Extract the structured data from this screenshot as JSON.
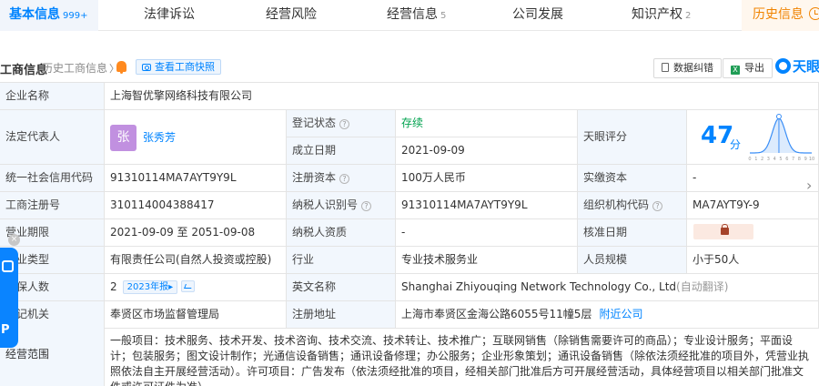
{
  "tabs": [
    {
      "label": "基本信息",
      "count": "999+"
    },
    {
      "label": "法律诉讼",
      "count": ""
    },
    {
      "label": "经营风险",
      "count": ""
    },
    {
      "label": "经营信息",
      "count": "5"
    },
    {
      "label": "公司发展",
      "count": ""
    },
    {
      "label": "知识产权",
      "count": "2"
    },
    {
      "label": "历史信息",
      "count": ""
    }
  ],
  "section": {
    "title": "工商信息",
    "history_link": "历史工商信息",
    "snapshot_label": "查看工商快照",
    "error_label": "数据纠错",
    "export_label": "导出",
    "logo_text": "天眼"
  },
  "info": {
    "company_name_label": "企业名称",
    "company_name": "上海智优擎网络科技有限公司",
    "legal_rep_label": "法定代表人",
    "legal_rep_avatar": "张",
    "legal_rep_name": "张秀芳",
    "reg_status_label": "登记状态",
    "reg_status": "存续",
    "est_date_label": "成立日期",
    "est_date": "2021-09-09",
    "tianyan_score_label": "天眼评分",
    "tianyan_score": "47",
    "score_unit": "分",
    "credit_code_label": "统一社会信用代码",
    "credit_code": "91310114MA7AYT9Y9L",
    "reg_capital_label": "注册资本",
    "reg_capital": "100万人民币",
    "paid_capital_label": "实缴资本",
    "paid_capital": "-",
    "reg_number_label": "工商注册号",
    "reg_number": "310114004388417",
    "taxpayer_id_label": "纳税人识别号",
    "taxpayer_id": "91310114MA7AYT9Y9L",
    "org_code_label": "组织机构代码",
    "org_code": "MA7AYT9Y-9",
    "term_label": "营业期限",
    "term": "2021-09-09 至 2051-09-08",
    "taxpayer_qual_label": "纳税人资质",
    "taxpayer_qual": "-",
    "approval_date_label": "核准日期",
    "company_type_label": "企业类型",
    "company_type": "有限责任公司(自然人投资或控股)",
    "industry_label": "行业",
    "industry": "专业技术服务业",
    "staff_size_label": "人员规模",
    "staff_size": "小于50人",
    "insured_label": "参保人数",
    "insured": "2",
    "insured_report": "2023年报",
    "english_name_label": "英文名称",
    "english_name": "Shanghai Zhiyouqing Network Technology Co., Ltd",
    "auto_translate": "(自动翻译)",
    "authority_label": "登记机关",
    "authority": "奉贤区市场监督管理局",
    "address_label": "注册地址",
    "address": "上海市奉贤区金海公路6055号11幢5层",
    "nearby_label": "附近公司",
    "scope_label": "经营范围",
    "scope": "一般项目：技术服务、技术开发、技术咨询、技术交流、技术转让、技术推广；互联网销售（除销售需要许可的商品）；专业设计服务；平面设计；包装服务；图文设计制作；光通信设备销售；通讯设备修理；办公服务；企业形象策划；通讯设备销售（除依法须经批准的项目外，凭营业执照依法自主开展经营活动）。许可项目：广告发布（依法须经批准的项目，经相关部门批准后方可开展经营活动，具体经营项目以相关部门批准文件或许可证件为准）。"
  },
  "score_chart": {
    "x_ticks": [
      "0",
      "1",
      "2",
      "3",
      "4",
      "5",
      "6",
      "7",
      "8",
      "9",
      "10"
    ],
    "marker_value": 47
  },
  "widget": {
    "close": "×"
  }
}
